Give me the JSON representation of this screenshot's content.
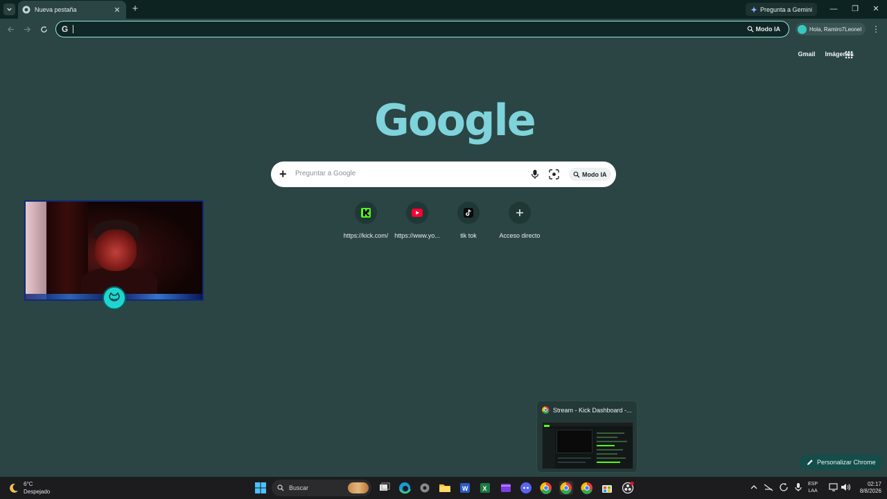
{
  "browser": {
    "tab": {
      "title": "Nueva pestaña"
    },
    "gemini_button": "Pregunta a Gemini",
    "omnibox": {
      "value": "",
      "ai_mode": "Modo IA"
    },
    "profile": {
      "greeting": "Hola, Ramiro7Leonel"
    }
  },
  "ntp": {
    "top_links": {
      "gmail": "Gmail",
      "images": "Imágenes"
    },
    "logo": "Google",
    "search": {
      "placeholder": "Preguntar a Google",
      "ai_mode": "Modo IA"
    },
    "shortcuts": [
      {
        "label": "https://kick.com/",
        "icon": "kick-icon"
      },
      {
        "label": "https://www.yo...",
        "icon": "youtube-icon"
      },
      {
        "label": "tik tok",
        "icon": "tiktok-icon"
      },
      {
        "label": "Acceso directo",
        "icon": "add-icon"
      }
    ],
    "customize_button": "Personalizar Chrome"
  },
  "preview": {
    "title": "Stream - Kick Dashboard -..."
  },
  "taskbar": {
    "weather": {
      "temp": "6°C",
      "condition": "Despejado"
    },
    "search_label": "Buscar",
    "language": {
      "top": "ESP",
      "bottom": "LAA"
    },
    "clock": {
      "time": "02:17",
      "date": "8/8/2026"
    }
  },
  "colors": {
    "background": "#2b4544",
    "accent": "#9fe6e0",
    "google_logo": "#7fd3da",
    "kick_green": "#53fc18",
    "youtube_red": "#ff0033"
  }
}
